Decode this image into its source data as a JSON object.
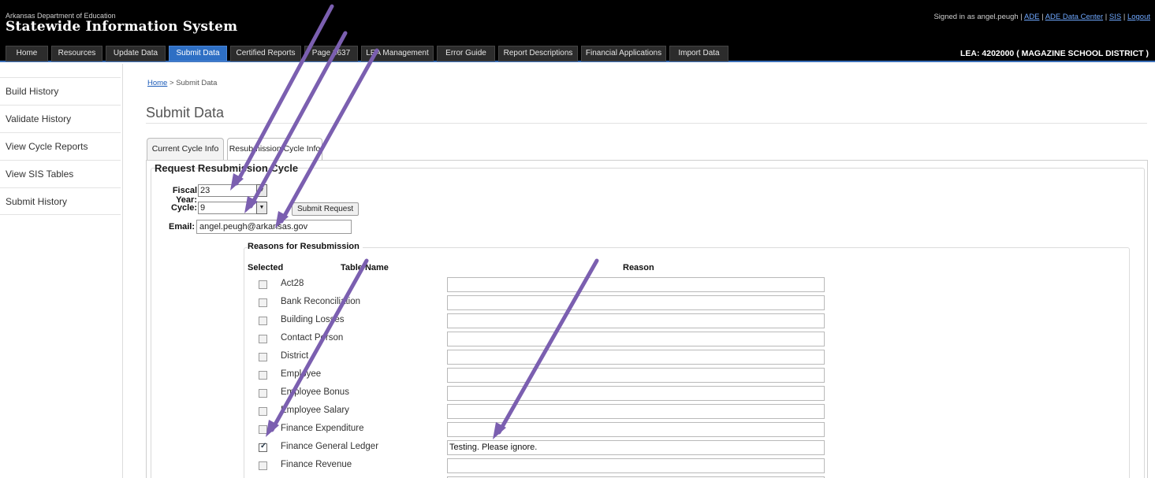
{
  "header": {
    "org": "Arkansas Department of Education",
    "system_title": "Statewide Information System",
    "signed_in_prefix": "Signed in as angel.peugh |",
    "links": [
      "ADE",
      "ADE Data Center",
      "SIS",
      "Logout"
    ],
    "lea": "LEA: 4202000 ( MAGAZINE SCHOOL DISTRICT )"
  },
  "nav": {
    "tabs": [
      "Home",
      "Resources",
      "Update Data",
      "Submit Data",
      "Certified Reports",
      "Page 3637",
      "LEA Management",
      "Error Guide",
      "Report Descriptions",
      "Financial Applications",
      "Import Data"
    ],
    "active": "Submit Data"
  },
  "sidebar": {
    "items": [
      "Build History",
      "Validate History",
      "View Cycle Reports",
      "View SIS Tables",
      "Submit History"
    ]
  },
  "breadcrumb": {
    "home": "Home",
    "separator": ">",
    "current": "Submit Data"
  },
  "page_title": "Submit Data",
  "tabs": [
    "Current Cycle Info",
    "Resubmission Cycle Info"
  ],
  "active_tab": "Resubmission Cycle Info",
  "form": {
    "section_title": "Request Resubmission Cycle",
    "fiscal_year_label": "Fiscal Year:",
    "fiscal_year_value": "23",
    "cycle_label": "Cycle:",
    "cycle_value": "9",
    "submit_label": "Submit Request",
    "email_label": "Email:",
    "email_value": "angel.peugh@arkansas.gov"
  },
  "reasons": {
    "legend": "Reasons for Resubmission",
    "headers": {
      "selected": "Selected",
      "table_name": "Table Name",
      "reason": "Reason"
    },
    "rows": [
      {
        "name": "Act28",
        "checked": false,
        "reason": ""
      },
      {
        "name": "Bank Reconciliation",
        "checked": false,
        "reason": ""
      },
      {
        "name": "Building Losses",
        "checked": false,
        "reason": ""
      },
      {
        "name": "Contact Person",
        "checked": false,
        "reason": ""
      },
      {
        "name": "District",
        "checked": false,
        "reason": ""
      },
      {
        "name": "Employee",
        "checked": false,
        "reason": ""
      },
      {
        "name": "Employee Bonus",
        "checked": false,
        "reason": ""
      },
      {
        "name": "Employee Salary",
        "checked": false,
        "reason": ""
      },
      {
        "name": "Finance Expenditure",
        "checked": false,
        "reason": ""
      },
      {
        "name": "Finance General Ledger",
        "checked": true,
        "reason": "Testing.  Please ignore."
      },
      {
        "name": "Finance Revenue",
        "checked": false,
        "reason": ""
      },
      {
        "name": "",
        "checked": false,
        "reason": ""
      }
    ]
  },
  "colors": {
    "header_bg": "#000000",
    "nav_active": "#2e6fc4",
    "link": "#1a5ab8",
    "annotation_arrow": "#7b5fb0"
  }
}
